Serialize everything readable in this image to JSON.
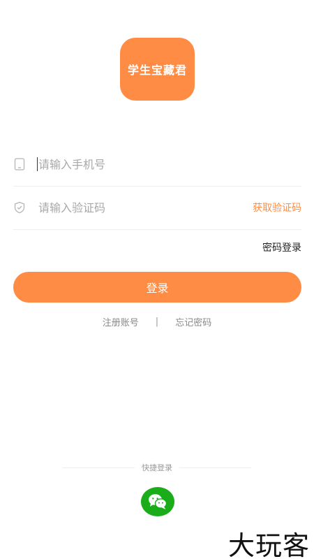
{
  "logo": {
    "text": "学生宝藏君",
    "color": "#ff8c45"
  },
  "phone_field": {
    "icon": "phone-icon",
    "placeholder": "请输入手机号",
    "value": ""
  },
  "code_field": {
    "icon": "shield-icon",
    "placeholder": "请输入验证码",
    "value": "",
    "get_code_label": "获取验证码"
  },
  "password_login_label": "密码登录",
  "login_button_label": "登录",
  "links": {
    "register": "注册账号",
    "separator": "|",
    "forgot": "忘记密码"
  },
  "quick_login": {
    "label": "快捷登录",
    "icon": "wechat-icon",
    "color": "#1aad19"
  },
  "watermark": "大玩客"
}
